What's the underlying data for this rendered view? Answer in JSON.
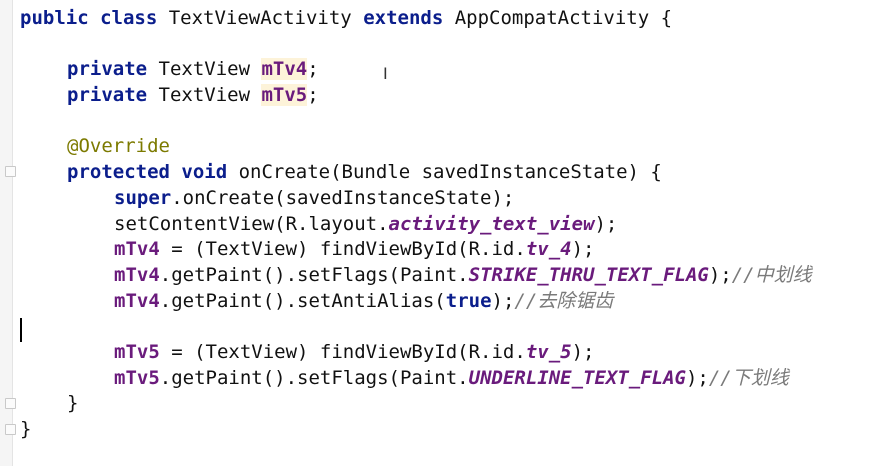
{
  "editor": {
    "lines": [
      {
        "indent": 0,
        "tokens": [
          {
            "t": "public class ",
            "c": "kw"
          },
          {
            "t": "TextViewActivity ",
            "c": "plain"
          },
          {
            "t": "extends ",
            "c": "kw"
          },
          {
            "t": "AppCompatActivity {",
            "c": "plain"
          }
        ]
      },
      {
        "indent": 0,
        "tokens": []
      },
      {
        "indent": 1,
        "tokens": [
          {
            "t": "private ",
            "c": "kw"
          },
          {
            "t": "TextView ",
            "c": "plain"
          },
          {
            "t": "mTv4",
            "c": "field-hl"
          },
          {
            "t": ";",
            "c": "plain"
          }
        ]
      },
      {
        "indent": 1,
        "tokens": [
          {
            "t": "private ",
            "c": "kw"
          },
          {
            "t": "TextView ",
            "c": "plain"
          },
          {
            "t": "mTv5",
            "c": "field-hl"
          },
          {
            "t": ";",
            "c": "plain"
          }
        ]
      },
      {
        "indent": 0,
        "tokens": []
      },
      {
        "indent": 1,
        "tokens": [
          {
            "t": "@Override",
            "c": "annot"
          }
        ]
      },
      {
        "indent": 1,
        "tokens": [
          {
            "t": "protected void ",
            "c": "kw"
          },
          {
            "t": "onCreate(Bundle savedInstanceState) {",
            "c": "plain"
          }
        ]
      },
      {
        "indent": 2,
        "tokens": [
          {
            "t": "super",
            "c": "kw"
          },
          {
            "t": ".onCreate(savedInstanceState);",
            "c": "plain"
          }
        ]
      },
      {
        "indent": 2,
        "tokens": [
          {
            "t": "setContentView(R.layout.",
            "c": "plain"
          },
          {
            "t": "activity_text_view",
            "c": "const"
          },
          {
            "t": ");",
            "c": "plain"
          }
        ]
      },
      {
        "indent": 2,
        "tokens": [
          {
            "t": "mTv4",
            "c": "field"
          },
          {
            "t": " = (TextView) findViewById(R.id.",
            "c": "plain"
          },
          {
            "t": "tv_4",
            "c": "const"
          },
          {
            "t": ");",
            "c": "plain"
          }
        ]
      },
      {
        "indent": 2,
        "tokens": [
          {
            "t": "mTv4",
            "c": "field"
          },
          {
            "t": ".getPaint().setFlags(Paint.",
            "c": "plain"
          },
          {
            "t": "STRIKE_THRU_TEXT_FLAG",
            "c": "const"
          },
          {
            "t": ");",
            "c": "plain"
          },
          {
            "t": "//中划线",
            "c": "comment"
          }
        ]
      },
      {
        "indent": 2,
        "tokens": [
          {
            "t": "mTv4",
            "c": "field"
          },
          {
            "t": ".getPaint().setAntiAlias(",
            "c": "plain"
          },
          {
            "t": "true",
            "c": "kw"
          },
          {
            "t": ");",
            "c": "plain"
          },
          {
            "t": "//去除锯齿",
            "c": "comment"
          }
        ]
      },
      {
        "indent": 0,
        "tokens": []
      },
      {
        "indent": 2,
        "tokens": [
          {
            "t": "mTv5",
            "c": "field"
          },
          {
            "t": " = (TextView) findViewById(R.id.",
            "c": "plain"
          },
          {
            "t": "tv_5",
            "c": "const"
          },
          {
            "t": ");",
            "c": "plain"
          }
        ]
      },
      {
        "indent": 2,
        "tokens": [
          {
            "t": "mTv5",
            "c": "field"
          },
          {
            "t": ".getPaint().setFlags(Paint.",
            "c": "plain"
          },
          {
            "t": "UNDERLINE_TEXT_FLAG",
            "c": "const"
          },
          {
            "t": ");",
            "c": "plain"
          },
          {
            "t": "//下划线",
            "c": "comment"
          }
        ]
      },
      {
        "indent": 1,
        "tokens": [
          {
            "t": "}",
            "c": "plain"
          }
        ]
      },
      {
        "indent": 0,
        "tokens": [
          {
            "t": "}",
            "c": "plain"
          }
        ]
      }
    ],
    "cursor_line": 13,
    "mouse_cursor_glyph": "I"
  }
}
